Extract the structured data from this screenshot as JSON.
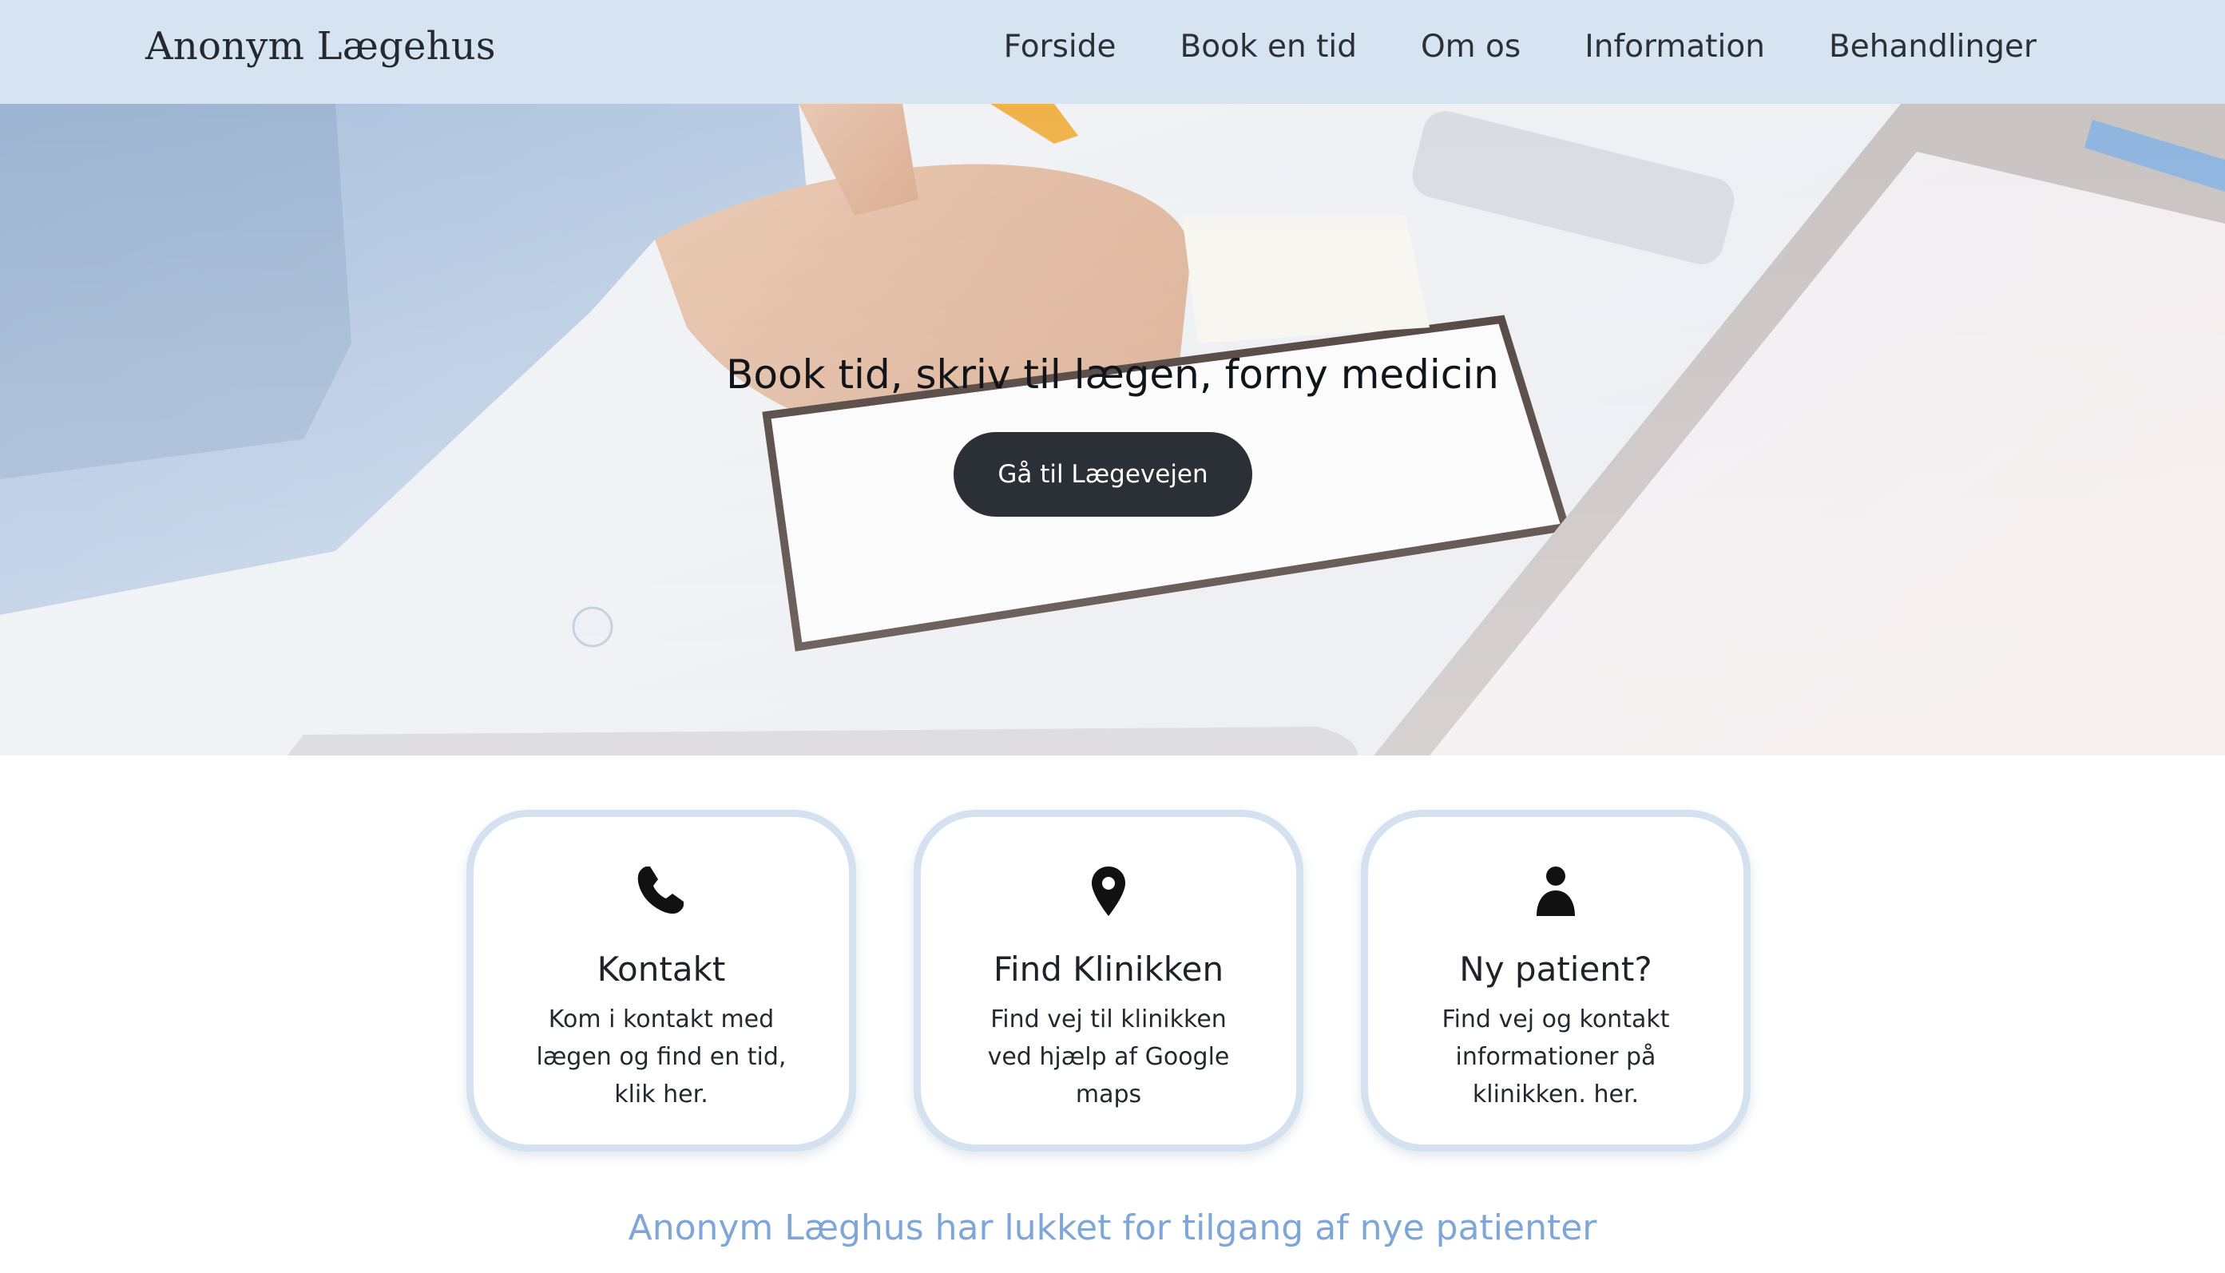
{
  "header": {
    "brand": "Anonym Lægehus",
    "nav": [
      "Forside",
      "Book en tid",
      "Om os",
      "Information",
      "Behandlinger"
    ]
  },
  "hero": {
    "title": "Book tid, skriv til lægen, forny medicin",
    "button_label": "Gå til Lægevejen"
  },
  "cards": [
    {
      "icon": "phone-icon",
      "title": "Kontakt",
      "lines": [
        "Kom i kontakt med",
        "lægen og find en tid,",
        "klik her."
      ]
    },
    {
      "icon": "map-pin-icon",
      "title": "Find Klinikken",
      "lines": [
        "Find vej til klinikken",
        "ved hjælp af Google",
        "maps"
      ]
    },
    {
      "icon": "user-icon",
      "title": "Ny patient?",
      "lines": [
        "Find vej og kontakt",
        "informationer på",
        "klinikken. her."
      ]
    }
  ],
  "notice": "Anonym Læghus har lukket for tilgang af nye patienter",
  "colors": {
    "navbar": "#d6e3f0",
    "button": "#2b2f36",
    "card_border": "#d4e1ef",
    "notice": "#7fa6d8"
  }
}
